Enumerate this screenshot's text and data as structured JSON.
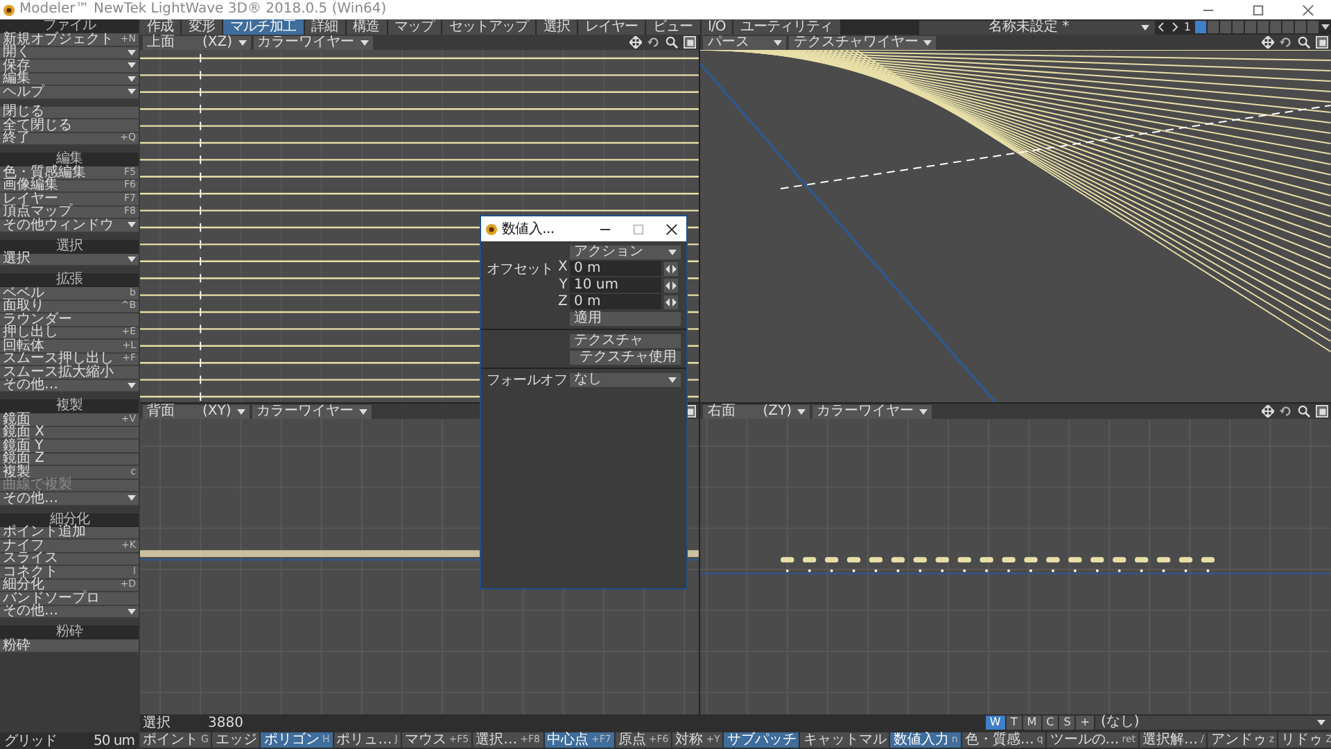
{
  "window": {
    "title": "Modeler™ NewTek LightWave 3D® 2018.0.5 (Win64)"
  },
  "tabs": [
    {
      "label": "作成",
      "selected": false
    },
    {
      "label": "変形",
      "selected": false
    },
    {
      "label": "マルチ加工",
      "selected": true
    },
    {
      "label": "詳細",
      "selected": false
    },
    {
      "label": "構造",
      "selected": false
    },
    {
      "label": "マップ",
      "selected": false
    },
    {
      "label": "セットアップ",
      "selected": false
    },
    {
      "label": "選択",
      "selected": false
    },
    {
      "label": "レイヤー",
      "selected": false
    },
    {
      "label": "ビュー",
      "selected": false
    },
    {
      "label": "I/O",
      "selected": false
    },
    {
      "label": "ユーティリティ",
      "selected": false
    }
  ],
  "object_selector": {
    "value": "名称未設定 *",
    "layer_number": "1",
    "layers": [
      {
        "selected": true
      },
      {
        "selected": false
      },
      {
        "selected": false
      },
      {
        "selected": false
      },
      {
        "selected": false
      },
      {
        "selected": false
      },
      {
        "selected": false
      },
      {
        "selected": false
      },
      {
        "selected": false
      },
      {
        "selected": false
      }
    ]
  },
  "sidebar": {
    "sections": [
      {
        "header": "ファイル",
        "items": [
          {
            "label": "新規オブジェクト",
            "shortcut": "+N",
            "kind": "command"
          },
          {
            "label": "開く",
            "kind": "menu"
          },
          {
            "label": "保存",
            "kind": "menu"
          },
          {
            "label": "編集",
            "kind": "menu"
          },
          {
            "label": "ヘルプ",
            "kind": "menu"
          }
        ]
      },
      {
        "items": [
          {
            "label": "閉じる",
            "kind": "command"
          },
          {
            "label": "全て閉じる",
            "kind": "command"
          },
          {
            "label": "終了",
            "shortcut": "+Q",
            "kind": "command"
          }
        ]
      },
      {
        "header": "編集",
        "items": [
          {
            "label": "色・質感編集",
            "shortcut": "F5",
            "kind": "command"
          },
          {
            "label": "画像編集",
            "shortcut": "F6",
            "kind": "command"
          },
          {
            "label": "レイヤー",
            "shortcut": "F7",
            "kind": "command"
          },
          {
            "label": "頂点マップ",
            "shortcut": "F8",
            "kind": "command"
          },
          {
            "label": "その他ウィンドウ",
            "kind": "menu"
          }
        ]
      },
      {
        "header": "選択",
        "items": [
          {
            "label": "選択",
            "kind": "menu"
          }
        ]
      },
      {
        "header": "拡張",
        "items": [
          {
            "label": "ベベル",
            "shortcut": "b",
            "kind": "command"
          },
          {
            "label": "面取り",
            "shortcut": "^B",
            "kind": "command"
          },
          {
            "label": "ラウンダー",
            "kind": "command"
          },
          {
            "label": "押し出し",
            "shortcut": "+E",
            "kind": "command"
          },
          {
            "label": "回転体",
            "shortcut": "+L",
            "kind": "command"
          },
          {
            "label": "スムース押し出し",
            "shortcut": "+F",
            "kind": "command"
          },
          {
            "label": "スムース拡大縮小",
            "kind": "command"
          },
          {
            "label": "その他…",
            "kind": "menu"
          }
        ]
      },
      {
        "header": "複製",
        "items": [
          {
            "label": "鏡面",
            "shortcut": "+V",
            "kind": "command"
          },
          {
            "label": "鏡面 X",
            "kind": "command"
          },
          {
            "label": "鏡面 Y",
            "kind": "command"
          },
          {
            "label": "鏡面 Z",
            "kind": "command"
          },
          {
            "label": "複製",
            "shortcut": "c",
            "kind": "command"
          },
          {
            "label": "曲線で複製",
            "kind": "inactive"
          },
          {
            "label": "その他…",
            "kind": "menu"
          }
        ]
      },
      {
        "header": "細分化",
        "items": [
          {
            "label": "ポイント追加",
            "kind": "command"
          },
          {
            "label": "ナイフ",
            "shortcut": "+K",
            "kind": "command"
          },
          {
            "label": "スライス",
            "kind": "command"
          },
          {
            "label": "コネクト",
            "shortcut": "l",
            "kind": "command"
          },
          {
            "label": "細分化",
            "shortcut": "+D",
            "kind": "command"
          },
          {
            "label": "バンドソープロ",
            "kind": "command"
          },
          {
            "label": "その他…",
            "kind": "menu"
          }
        ]
      },
      {
        "header": "粉砕",
        "items": [
          {
            "label": "粉砕",
            "kind": "command"
          }
        ]
      }
    ],
    "grid": {
      "label": "グリッド",
      "value": "50 um"
    }
  },
  "viewports": [
    {
      "kind": "top",
      "view": "上面",
      "axes": "(XZ)",
      "mode": "カラーワイヤー"
    },
    {
      "kind": "perspective",
      "view": "パース",
      "mode": "テクスチャワイヤー"
    },
    {
      "kind": "back",
      "view": "背面",
      "axes": "(XY)",
      "mode": "カラーワイヤー"
    },
    {
      "kind": "right",
      "view": "右面",
      "axes": "(ZY)",
      "mode": "カラーワイヤー"
    }
  ],
  "numeric_dialog": {
    "title": "数値入...",
    "action": "アクション",
    "offset_label": "オフセット",
    "fields": [
      {
        "axis": "X",
        "value": "0 m"
      },
      {
        "axis": "Y",
        "value": "10 um"
      },
      {
        "axis": "Z",
        "value": "0 m"
      }
    ],
    "apply": "適用",
    "texture": "テクスチャ",
    "use_texture": "テクスチャ使用",
    "falloff_label": "フォールオフ",
    "falloff": "なし"
  },
  "status_bar": {
    "selection_label": "選択",
    "selection_count": "3880",
    "view_buttons": [
      {
        "label": "W",
        "selected": true
      },
      {
        "label": "T",
        "selected": false
      },
      {
        "label": "M",
        "selected": false
      },
      {
        "label": "C",
        "selected": false
      },
      {
        "label": "S",
        "selected": false
      },
      {
        "label": "+",
        "selected": false
      }
    ],
    "surface": "(なし)"
  },
  "bottom_toolbar": [
    {
      "label": "ポイント",
      "shortcut": "G",
      "selected": false
    },
    {
      "label": "エッジ",
      "selected": false
    },
    {
      "label": "ポリゴン",
      "shortcut": "H",
      "selected": true
    },
    {
      "label": "ポリュ…",
      "shortcut": "J",
      "selected": false
    },
    {
      "label": "マウス",
      "shortcut": "+F5",
      "selected": false
    },
    {
      "label": "選択…",
      "shortcut": "+F8",
      "selected": false
    },
    {
      "label": "中心点",
      "shortcut": "+F7",
      "selected": true
    },
    {
      "label": "原点",
      "shortcut": "+F6",
      "selected": false
    },
    {
      "label": "対称",
      "shortcut": "+Y",
      "selected": false
    },
    {
      "label": "サブパッチ",
      "selected": true
    },
    {
      "label": "キャットマル",
      "selected": false
    },
    {
      "label": "数値入力",
      "shortcut": "n",
      "selected": true
    },
    {
      "label": "色・質感…",
      "shortcut": "q",
      "selected": false
    },
    {
      "label": "ツールの…",
      "shortcut": "ret",
      "selected": false
    },
    {
      "label": "選択解…",
      "shortcut": "/",
      "selected": false
    },
    {
      "label": "アンドゥ",
      "shortcut": "z",
      "selected": false
    },
    {
      "label": "リドゥ",
      "shortcut": "Z",
      "selected": false
    }
  ]
}
